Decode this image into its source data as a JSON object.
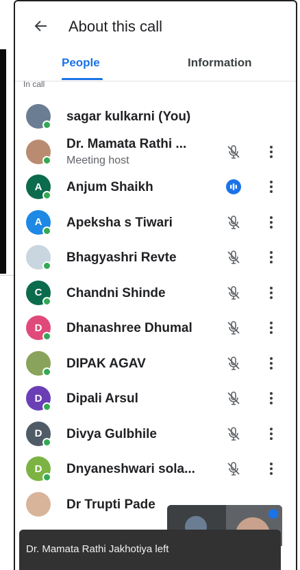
{
  "header": {
    "title": "About this call"
  },
  "tabs": [
    {
      "label": "People",
      "selected": true
    },
    {
      "label": "Information",
      "selected": false
    }
  ],
  "section_label": "In call",
  "participants": [
    {
      "name": "sagar kulkarni (You)",
      "avatar": "photo",
      "avatar_color": "#6b7d93",
      "mic": "none"
    },
    {
      "name": "Dr. Mamata Rathi ...",
      "sub": "Meeting host",
      "avatar": "photo",
      "avatar_color": "#b98c72",
      "mic": "muted"
    },
    {
      "name": "Anjum Shaikh",
      "avatar": "A",
      "avatar_color": "#0b6b4c",
      "mic": "speaking"
    },
    {
      "name": "Apeksha s Tiwari",
      "avatar": "A",
      "avatar_color": "#1e88e5",
      "mic": "muted"
    },
    {
      "name": "Bhagyashri Revte",
      "avatar": "photo",
      "avatar_color": "#c9d6df",
      "mic": "muted"
    },
    {
      "name": "Chandni Shinde",
      "avatar": "C",
      "avatar_color": "#0b6b4c",
      "mic": "muted"
    },
    {
      "name": "Dhanashree Dhumal",
      "avatar": "D",
      "avatar_color": "#e04a7a",
      "mic": "muted"
    },
    {
      "name": "DIPAK AGAV",
      "avatar": "photo",
      "avatar_color": "#8aa35c",
      "mic": "muted"
    },
    {
      "name": "Dipali Arsul",
      "avatar": "D",
      "avatar_color": "#6a3fb5",
      "mic": "muted"
    },
    {
      "name": "Divya Gulbhile",
      "avatar": "D",
      "avatar_color": "#4f5b66",
      "mic": "muted"
    },
    {
      "name": "Dnyaneshwari sola...",
      "avatar": "D",
      "avatar_color": "#7cb342",
      "mic": "muted"
    },
    {
      "name": "Dr Trupti Pade",
      "avatar": "photo",
      "avatar_color": "#d8b49a",
      "mic": "hidden"
    }
  ],
  "toast": {
    "text": "Dr. Mamata Rathi Jakhotiya left"
  },
  "colors": {
    "accent": "#1a73e8",
    "presence": "#34a853"
  }
}
